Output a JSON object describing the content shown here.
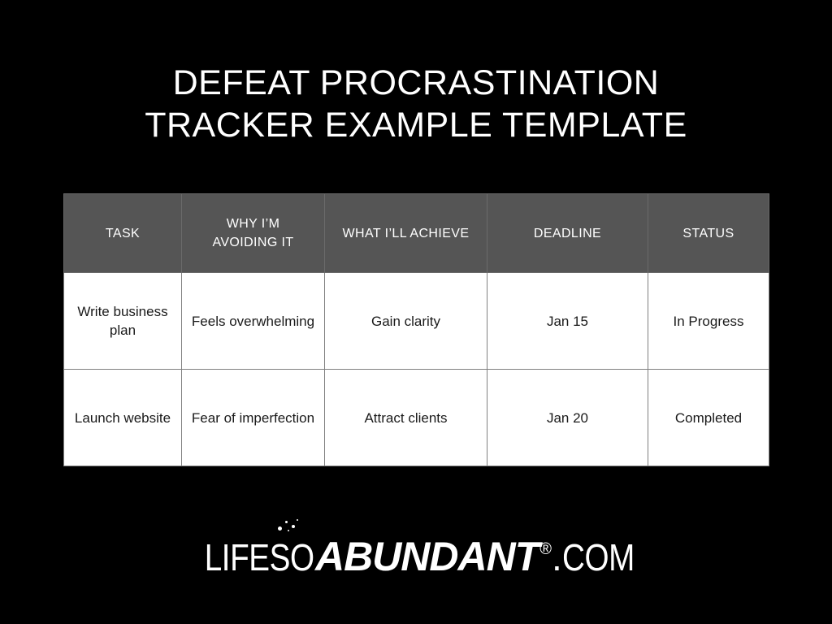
{
  "slide": {
    "background_color": "#000000",
    "text_color": "#ffffff"
  },
  "title": {
    "line1": "DEFEAT PROCRASTINATION",
    "line2": "TRACKER EXAMPLE TEMPLATE"
  },
  "table": {
    "header_background": "#555555",
    "header_text_color": "#ffffff",
    "body_background": "#ffffff",
    "body_text_color": "#1a1a1a",
    "border_color": "#808080",
    "columns": [
      {
        "key": "task",
        "label": "TASK"
      },
      {
        "key": "why",
        "label": "WHY I’M AVOIDING IT"
      },
      {
        "key": "achieve",
        "label": "WHAT I’LL ACHIEVE"
      },
      {
        "key": "dead",
        "label": "DEADLINE"
      },
      {
        "key": "status",
        "label": "STATUS"
      }
    ],
    "header_label_lines": {
      "task": [
        "TASK"
      ],
      "why": [
        "WHY I’M",
        "AVOIDING IT"
      ],
      "achieve": [
        "WHAT I’LL ACHIEVE"
      ],
      "dead": [
        "DEADLINE"
      ],
      "status": [
        "STATUS"
      ]
    },
    "rows": [
      {
        "task": "Write business plan",
        "why": "Feels overwhelming",
        "achieve": "Gain clarity",
        "dead": "Jan 15",
        "status": "In Progress"
      },
      {
        "task": "Launch website",
        "why": "Fear of imperfection",
        "achieve": "Attract clients",
        "dead": "Jan 20",
        "status": "Completed"
      }
    ]
  },
  "logo": {
    "light_prefix": "LIFESO",
    "bold_word": "ABUNDANT",
    "registered_mark": "®",
    "dot": ".",
    "suffix": "COM",
    "full_text": "LIFESOABUNDANT®.COM"
  }
}
